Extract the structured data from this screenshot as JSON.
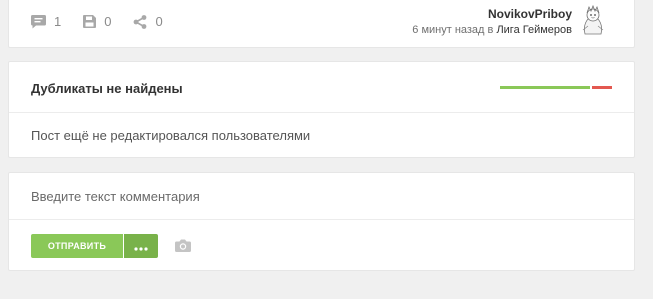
{
  "post_footer": {
    "comments_count": "1",
    "saves_count": "0",
    "shares_count": "0",
    "author": "NovikovPriboy",
    "time_ago": "6 минут назад в",
    "community": "Лига Геймеров"
  },
  "duplicates": {
    "title": "Дубликаты не найдены",
    "edit_info": "Пост ещё не редактировался пользователями"
  },
  "comment_form": {
    "placeholder": "Введите текст комментария",
    "send_label": "ОТПРАВИТЬ"
  },
  "colors": {
    "accent_green": "#8ac858",
    "accent_green_dark": "#79b24a",
    "indicator_red": "#e35850"
  }
}
